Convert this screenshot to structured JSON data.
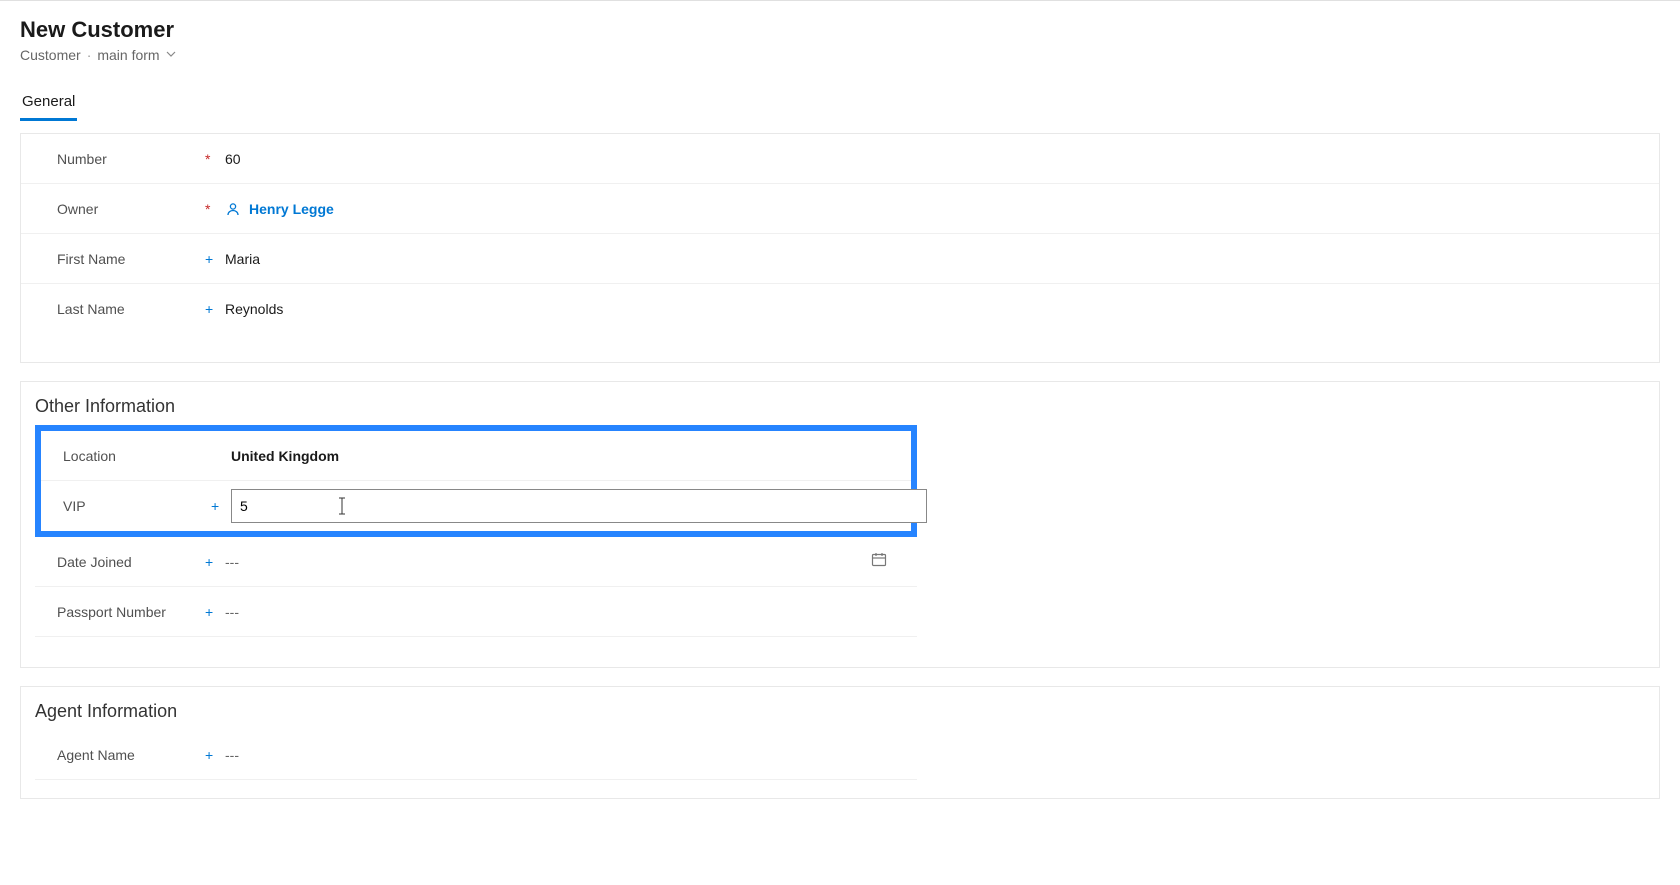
{
  "header": {
    "title": "New Customer",
    "breadcrumb_entity": "Customer",
    "breadcrumb_form": "main form"
  },
  "tabs": {
    "general": "General"
  },
  "fields": {
    "number_label": "Number",
    "number_value": "60",
    "owner_label": "Owner",
    "owner_value": "Henry Legge",
    "first_name_label": "First Name",
    "first_name_value": "Maria",
    "last_name_label": "Last Name",
    "last_name_value": "Reynolds"
  },
  "other_info": {
    "section_title": "Other Information",
    "location_label": "Location",
    "location_value": "United Kingdom",
    "vip_label": "VIP",
    "vip_value": "5",
    "date_joined_label": "Date Joined",
    "date_joined_value": "---",
    "passport_label": "Passport Number",
    "passport_value": "---"
  },
  "agent_info": {
    "section_title": "Agent Information",
    "agent_name_label": "Agent Name",
    "agent_name_value": "---"
  },
  "icons": {
    "chevron_down": "˅",
    "person": "person",
    "calendar": "calendar",
    "text_cursor": "I"
  }
}
